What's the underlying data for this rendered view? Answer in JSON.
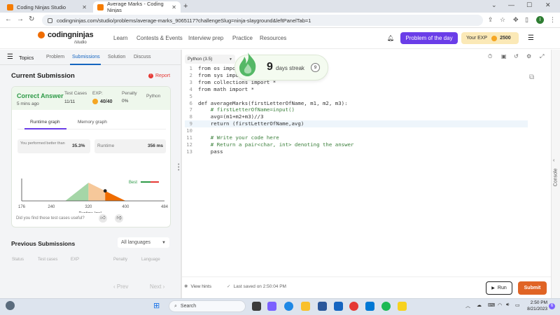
{
  "browser": {
    "tabs": [
      {
        "label": "Coding Ninjas Studio",
        "active": false
      },
      {
        "label": "Average Marks - Coding Ninjas",
        "active": true
      }
    ],
    "url": "codingninjas.com/studio/problems/average-marks_9065117?challengeSlug=ninja-slayground&leftPanelTab=1",
    "profile_initial": "I"
  },
  "site": {
    "logo_name": "codingninjas",
    "logo_sub": "/studio",
    "nav": [
      "Learn",
      "Contests & Events",
      "Interview prep",
      "Practice",
      "Resources"
    ],
    "problem_of_day": "Problem of the day",
    "exp_label": "Your EXP",
    "exp_value": "2500"
  },
  "left": {
    "tabs": [
      "Topics",
      "Problem",
      "Submissions",
      "Solution",
      "Discuss"
    ],
    "active_tab": "Submissions",
    "current_title": "Current Submission",
    "report": "Report",
    "card": {
      "status": "Correct Answer",
      "time": "5 mins ago",
      "test_cases_label": "Test Cases",
      "test_cases_value": "11/11",
      "exp_label": "EXP:",
      "exp_value": "40/40",
      "penalty_label": "Penalty",
      "penalty_value": "0%",
      "lang_label": "Python",
      "graph_tabs": [
        "Runtime graph",
        "Memory graph"
      ],
      "perf_label": "You performed better than",
      "perf_value": "35.3%",
      "runtime_label": "Runtime",
      "runtime_value": "356 ms",
      "feedback": "Did you find these test cases useful?"
    },
    "previous_title": "Previous Submissions",
    "lang_filter": "All languages",
    "columns": [
      "Status",
      "Test cases",
      "EXP",
      "Penalty",
      "Language"
    ],
    "pager_prev": "‹ Prev",
    "pager_next": "Next ›"
  },
  "chart_data": {
    "type": "area",
    "xlabel": "Runtime (ms)",
    "x_ticks": [
      176,
      240,
      320,
      400,
      484
    ],
    "xlim": [
      176,
      484
    ],
    "legend_label": "Best",
    "marker_x": 356,
    "distribution": [
      {
        "x": 270,
        "y": 0
      },
      {
        "x": 320,
        "y": 1
      },
      {
        "x": 400,
        "y": 0
      }
    ],
    "colors": {
      "best": "#a5d6a7",
      "peak": "#f6c89a",
      "worse": "#ef6c00"
    }
  },
  "editor": {
    "language": "Python (3.5)",
    "lines": [
      "from os import *",
      "from sys import *",
      "from collections import *",
      "from math import *",
      "",
      "def averageMarks(firstLetterOfName, m1, m2, m3):",
      "    # firstLetterOfName=input()",
      "    avg=(m1+m2+m3)//3",
      "    return (firstLetterOfName,avg)",
      "",
      "    # Write your code here",
      "    # Return a pair<char, int> denoting the answer",
      "    pass"
    ],
    "highlight_line": 9,
    "streak_value": "9",
    "streak_label": "days streak",
    "streak_badge": "9",
    "console_label": "Console",
    "view_hints": "View hints",
    "saved_text": "Last saved on 2:50:04 PM",
    "run_label": "Run",
    "submit_label": "Submit"
  },
  "taskbar": {
    "search_placeholder": "Search",
    "time": "2:50 PM",
    "date": "8/21/2023",
    "notif_count": "6"
  },
  "colors": {
    "accent_purple": "#6a3de8",
    "success_green": "#2e9a47",
    "submit_orange": "#e06425",
    "link_blue": "#1565c0"
  }
}
